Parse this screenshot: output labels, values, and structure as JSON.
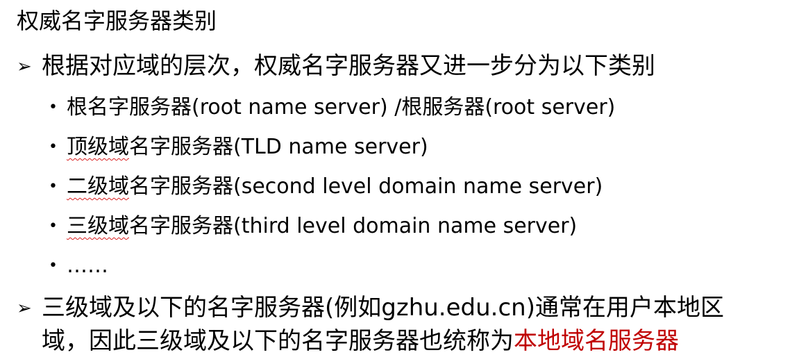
{
  "slide": {
    "title": "权威名字服务器类别",
    "point1": {
      "bullet_glyph": "➢",
      "text": "根据对应域的层次，权威名字服务器又进一步分为以下类别"
    },
    "subitems": [
      {
        "bullet": "•",
        "prefix": "",
        "text": "根名字服务器(root name server) /根服务器(root server)"
      },
      {
        "bullet": "•",
        "prefix": "顶级域",
        "text": "名字服务器(TLD name server)"
      },
      {
        "bullet": "•",
        "prefix": "二级域",
        "text": "名字服务器(second level domain name server)"
      },
      {
        "bullet": "•",
        "prefix": "三级域",
        "text": "名字服务器(third level domain name server)"
      },
      {
        "bullet": "•",
        "prefix": "",
        "text": "……"
      }
    ],
    "point2": {
      "bullet_glyph": "➢",
      "line1": "三级域及以下的名字服务器(例如gzhu.edu.cn)通常在用户本地区",
      "line2_plain": "域，因此三级域及以下的名字服务器也统称为",
      "line2_highlight": "本地域名服务器",
      "highlight_color": "#c00000"
    }
  }
}
